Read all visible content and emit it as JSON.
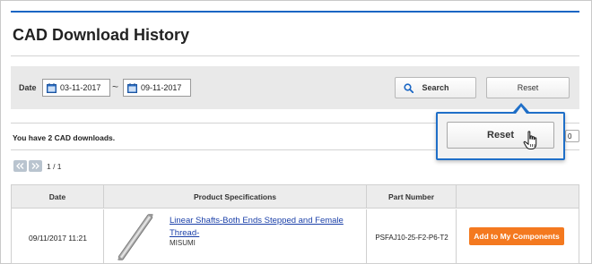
{
  "page": {
    "title": "CAD Download History"
  },
  "filter": {
    "date_label": "Date",
    "date_from": "03-11-2017",
    "separator": "~",
    "date_to": "09-11-2017",
    "search_label": "Search",
    "reset_label": "Reset"
  },
  "summary": {
    "count_text": "You have 2 CAD downloads.",
    "per_page_value": "0"
  },
  "pagination": {
    "page_indicator": "1 / 1"
  },
  "table": {
    "headers": [
      "Date",
      "Product Specifications",
      "Part Number",
      ""
    ],
    "rows": [
      {
        "date": "09/11/2017 11:21",
        "spec": "Linear Shafts-Both Ends Stepped and Female Thread-",
        "maker": "MISUMI",
        "part_number": "PSFAJ10-25-F2-P6-T2",
        "action_label": "Add to My Components"
      }
    ]
  },
  "callout": {
    "button_label": "Reset"
  },
  "colors": {
    "accent": "#1a66c4",
    "action_orange": "#f4791f",
    "link_blue": "#1a3fa8"
  }
}
